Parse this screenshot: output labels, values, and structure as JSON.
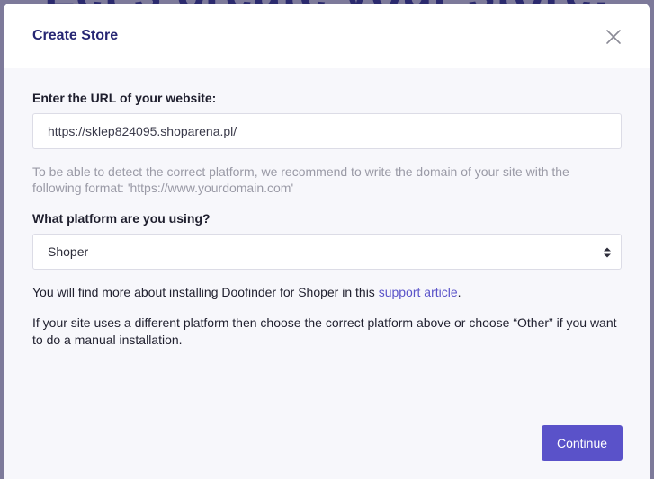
{
  "background": {
    "heading": "Let's create your store!"
  },
  "modal": {
    "title": "Create Store",
    "close_icon": "close-icon",
    "url_label": "Enter the URL of your website:",
    "url_value": "https://sklep824095.shoparena.pl/",
    "url_hint": "To be able to detect the correct platform, we recommend to write the domain of your site with the following format: 'https://www.yourdomain.com'",
    "platform_label": "What platform are you using?",
    "platform_selected": "Shoper",
    "platform_arrows_icon": "select-arrows-icon",
    "info_prefix": "You will find more about installing Doofinder for Shoper in this ",
    "info_link": "support article",
    "info_suffix": ".",
    "other_info": "If your site uses a different platform then choose the correct platform above or choose “Other” if you want to do a manual installation.",
    "continue_label": "Continue"
  },
  "colors": {
    "accent": "#5a52c9",
    "title": "#262673",
    "backdrop": "#7d7a9a"
  }
}
